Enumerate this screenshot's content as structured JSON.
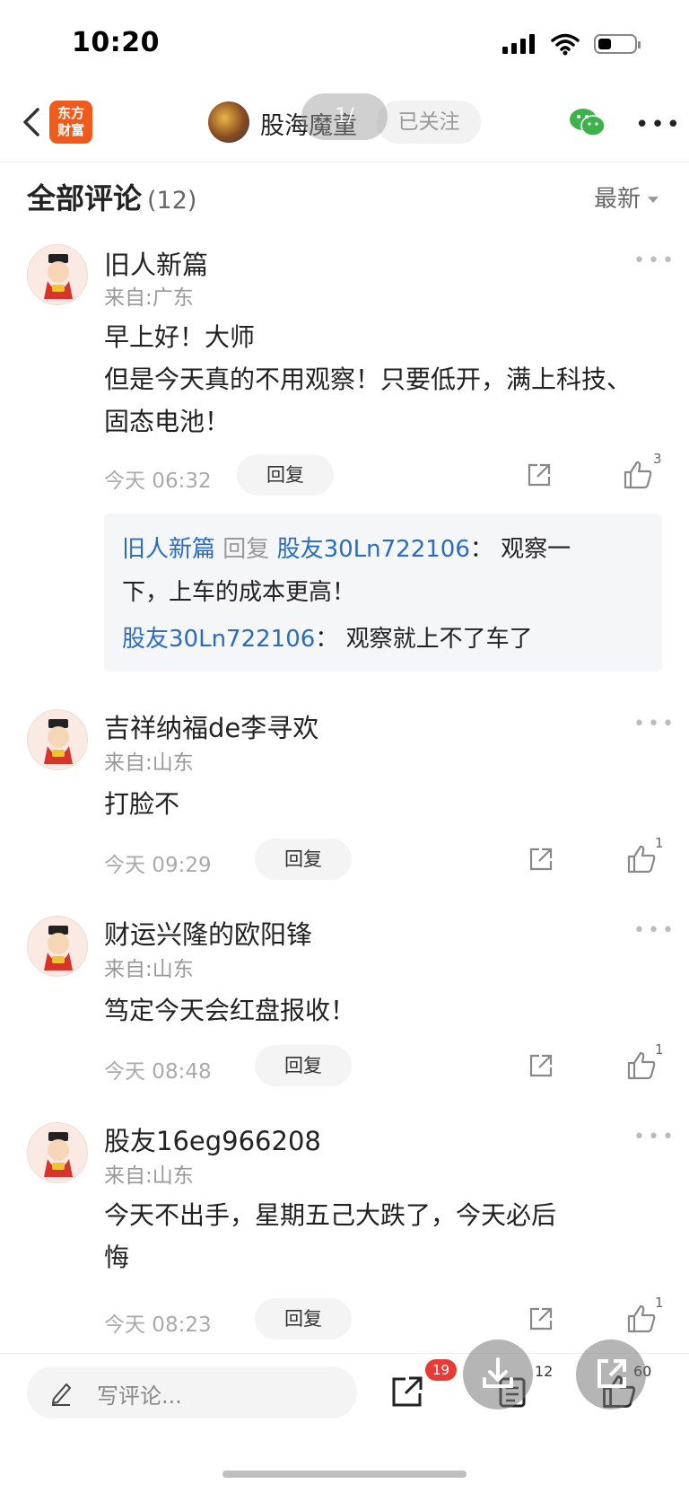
{
  "status_bar": {
    "time": "10:20"
  },
  "nav": {
    "logo_line1": "东方",
    "logo_line2": "财富",
    "author_name": "股海魔童",
    "overlay_pill": "1/",
    "follow_label": "已关注"
  },
  "comments_header": {
    "title": "全部评论",
    "count": "(12)",
    "sort_label": "最新"
  },
  "comments": [
    {
      "name": "旧人新篇",
      "location": "来自:广东",
      "lines": [
        "早上好！大师",
        "但是今天真的不用观察！只要低开，满上科技、",
        "固态电池！"
      ],
      "time": "今天 06:32",
      "reply_label": "回复",
      "likes": "3",
      "replies": [
        {
          "from": "旧人新篇",
          "verb": "回复",
          "to": "股友30Ln722106",
          "colon": "：",
          "text_a": "观察一",
          "text_b": "下，上车的成本更高！"
        },
        {
          "from": "股友30Ln722106",
          "colon": "：",
          "text": "观察就上不了车了"
        }
      ]
    },
    {
      "name": "吉祥纳福de李寻欢",
      "location": "来自:山东",
      "lines": [
        "打脸不"
      ],
      "time": "今天 09:29",
      "reply_label": "回复",
      "likes": "1"
    },
    {
      "name": "财运兴隆的欧阳锋",
      "location": "来自:山东",
      "lines": [
        "笃定今天会红盘报收！"
      ],
      "time": "今天 08:48",
      "reply_label": "回复",
      "likes": "1"
    },
    {
      "name": "股友16eg966208",
      "location": "来自:山东",
      "lines": [
        "今天不出手，星期五己大跌了，今天必后",
        "悔"
      ],
      "time": "今天 08:23",
      "reply_label": "回复",
      "likes": "1"
    }
  ],
  "bottom_bar": {
    "write_placeholder": "写评论...",
    "share_badge": "19",
    "comment_count": "12",
    "like_count": "60"
  }
}
